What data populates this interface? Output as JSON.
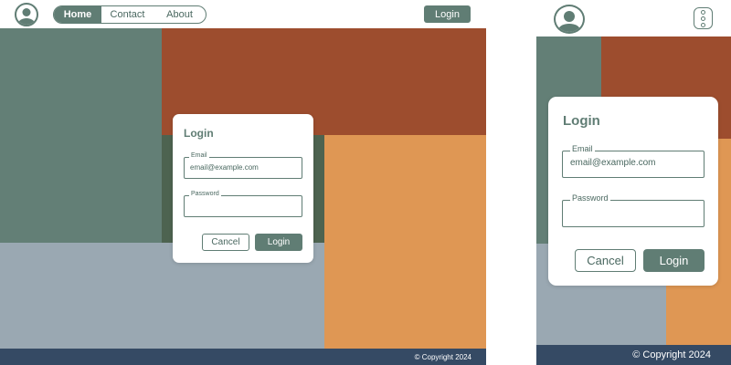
{
  "colors": {
    "accent": "#607d74",
    "block_sage": "#637f76",
    "block_rust": "#9d4d2e",
    "block_dark_green": "#4d6350",
    "block_orange": "#df9754",
    "block_gray_blue": "#9aa8b2",
    "footer": "#354a64"
  },
  "header": {
    "avatar_icon": "user-avatar-icon",
    "nav": [
      {
        "label": "Home",
        "active": true
      },
      {
        "label": "Contact",
        "active": false
      },
      {
        "label": "About",
        "active": false
      }
    ],
    "login_label": "Login",
    "menu_icon": "vertical-dots-menu-icon"
  },
  "login_dialog": {
    "title": "Login",
    "email_label": "Email",
    "email_value": "email@example.com",
    "password_label": "Password",
    "password_value": "",
    "cancel_label": "Cancel",
    "submit_label": "Login"
  },
  "footer": {
    "copyright": "© Copyright 2024"
  }
}
